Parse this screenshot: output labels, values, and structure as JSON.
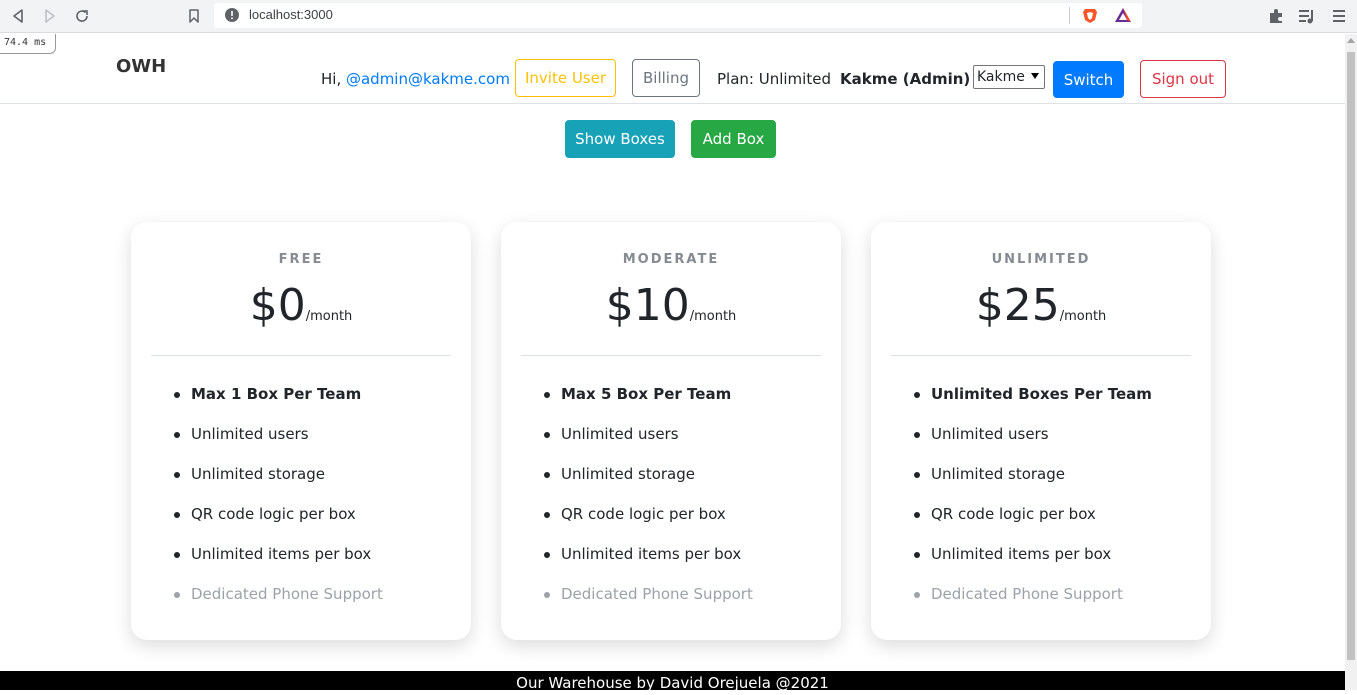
{
  "browser": {
    "url": "localhost:3000",
    "timing": "74.4 ms"
  },
  "navbar": {
    "brand": "OWH",
    "greeting_prefix": "Hi, ",
    "user": "@admin@kakme.com",
    "invite_label": "Invite User",
    "billing_label": "Billing",
    "plan": "Plan: Unlimited",
    "team": "Kakme (Admin)",
    "team_select": "Kakme",
    "switch_label": "Switch",
    "signout_label": "Sign out"
  },
  "actions": {
    "show_boxes": "Show Boxes",
    "add_box": "Add Box"
  },
  "plans": [
    {
      "title": "FREE",
      "price": "$0",
      "period": "/month",
      "features": [
        "Max 1 Box Per Team",
        "Unlimited users",
        "Unlimited storage",
        "QR code logic per box",
        "Unlimited items per box",
        "Dedicated Phone Support"
      ]
    },
    {
      "title": "MODERATE",
      "price": "$10",
      "period": "/month",
      "features": [
        "Max 5 Box Per Team",
        "Unlimited users",
        "Unlimited storage",
        "QR code logic per box",
        "Unlimited items per box",
        "Dedicated Phone Support"
      ]
    },
    {
      "title": "UNLIMITED",
      "price": "$25",
      "period": "/month",
      "features": [
        "Unlimited Boxes Per Team",
        "Unlimited users",
        "Unlimited storage",
        "QR code logic per box",
        "Unlimited items per box",
        "Dedicated Phone Support"
      ]
    }
  ],
  "footer": "Our Warehouse by David Orejuela @2021",
  "colors": {
    "primary": "#007bff",
    "warning": "#ffc107",
    "secondary": "#6c757d",
    "danger": "#dc3545",
    "info": "#17a2b8",
    "success": "#28a745"
  }
}
